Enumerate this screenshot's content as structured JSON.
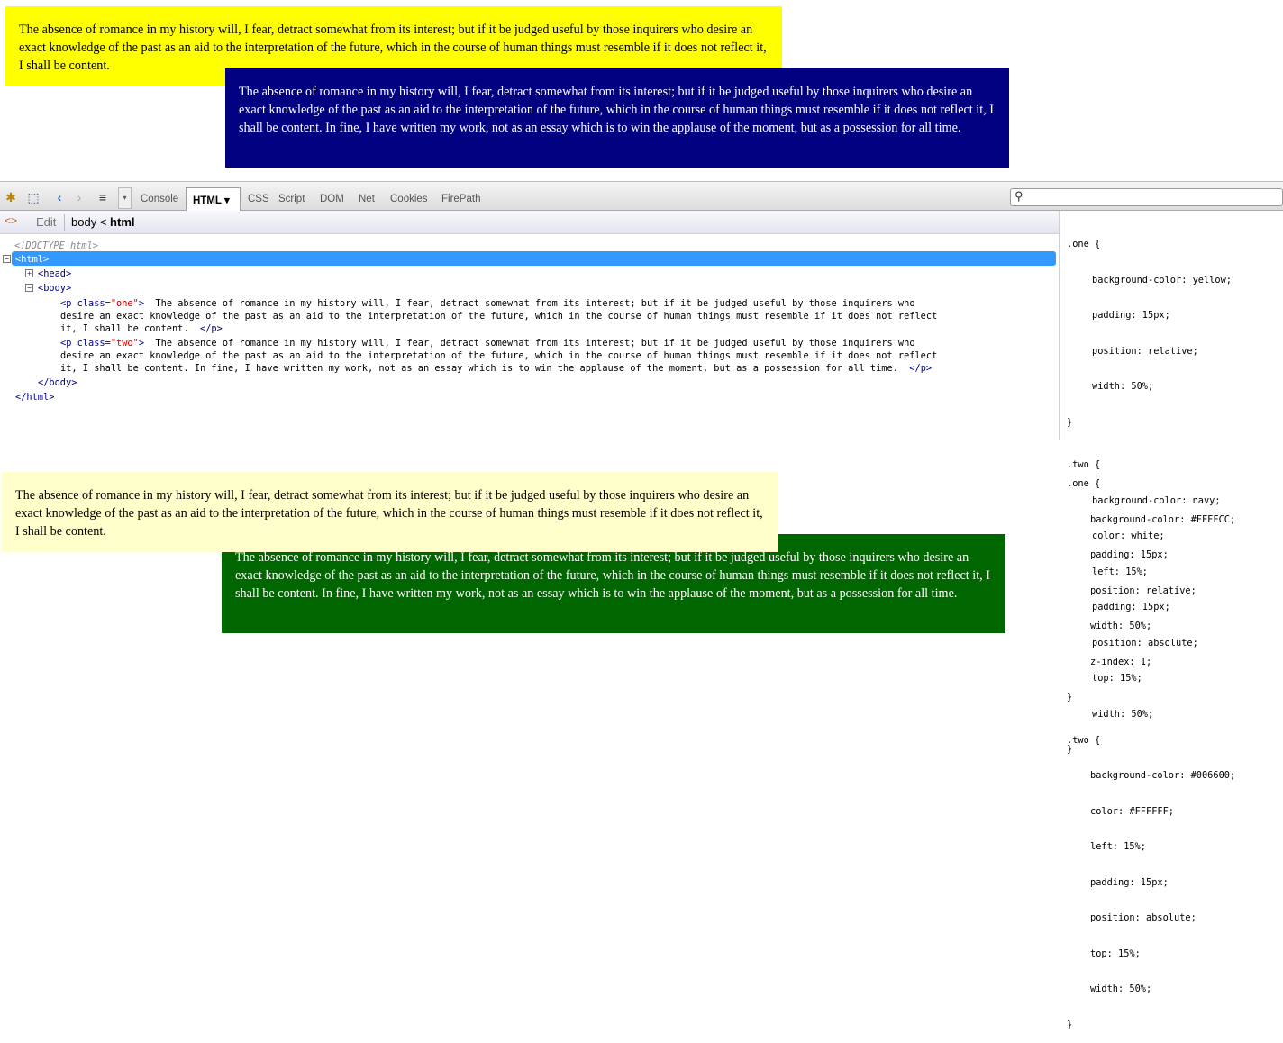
{
  "paragraphs": {
    "one": "The absence of romance in my history will, I fear, detract somewhat from its interest; but if it be judged useful by those inquirers who desire an exact knowledge of the past as an aid to the interpretation of the future, which in the course of human things must resemble if it does not reflect it, I shall be content.",
    "two": "The absence of romance in my history will, I fear, detract somewhat from its interest; but if it be judged useful by those inquirers who desire an exact knowledge of the past as an aid to the interpretation of the future, which in the course of human things must resemble if it does not reflect it, I shall be content. In fine, I have written my work, not as an essay which is to win the applause of the moment, but as a possession for all time."
  },
  "colors": {
    "yellow": "#ffff00",
    "navy": "#000080",
    "light_yellow": "#FFFFCC",
    "green": "#006600",
    "selection": "#3399ff"
  },
  "toolbar": {
    "tabs": [
      "Console",
      "HTML",
      "CSS",
      "Script",
      "DOM",
      "Net",
      "Cookies",
      "FirePath"
    ],
    "active_tab": "HTML",
    "icons": [
      "firebug-icon",
      "inspect-icon",
      "back-icon",
      "forward-icon",
      "menu-icon",
      "dropdown-icon",
      "search-icon"
    ]
  },
  "breadcrumb": {
    "edit_label": "Edit",
    "path_body": "body",
    "path_sep": "<",
    "path_html": "html"
  },
  "html_tree": {
    "doctype": "<!DOCTYPE html>",
    "html_open": "<html>",
    "head": "<head>",
    "body_open": "<body>",
    "p_one_open_tag": "<p",
    "p_one_attr": "class=",
    "p_one_val": "\"one\"",
    "p_close_bracket": ">",
    "p_one_text_1": "The absence of romance in my history will, I fear, detract somewhat from its interest; but if it be judged useful by those inquirers who",
    "p_one_text_2": "desire an exact knowledge of the past as an aid to the interpretation of the future, which in the course of human things must resemble if it does not reflect",
    "p_one_text_3": "it, I shall be content.",
    "p_close": "</p>",
    "p_two_val": "\"two\"",
    "p_two_text_1": "The absence of romance in my history will, I fear, detract somewhat from its interest; but if it be judged useful by those inquirers who",
    "p_two_text_2": "desire an exact knowledge of the past as an aid to the interpretation of the future, which in the course of human things must resemble if it does not reflect",
    "p_two_text_3": "it, I shall be content. In fine, I have written my work, not as an essay which is to win the applause of the moment, but as a possession for all time.",
    "body_close": "</body>",
    "html_close": "</html>"
  },
  "css_rules_top": {
    "one": {
      "selector": ".one {",
      "lines": [
        "background-color: yellow;",
        "padding: 15px;",
        "position: relative;",
        "width: 50%;"
      ],
      "close": "}"
    },
    "two": {
      "selector": ".two {",
      "lines": [
        "background-color: navy;",
        "color: white;",
        "left: 15%;",
        "padding: 15px;",
        "position: absolute;",
        "top: 15%;",
        "width: 50%;"
      ],
      "close": "}"
    }
  },
  "css_rules_bottom": {
    "one": {
      "selector": ".one {",
      "lines": [
        "background-color: #FFFFCC;",
        "padding: 15px;",
        "position: relative;",
        "width: 50%;",
        "z-index: 1;"
      ],
      "close": "}"
    },
    "two": {
      "selector": ".two {",
      "lines": [
        "background-color: #006600;",
        "color: #FFFFFF;",
        "left: 15%;",
        "padding: 15px;",
        "position: absolute;",
        "top: 15%;",
        "width: 50%;"
      ],
      "close": "}"
    }
  }
}
